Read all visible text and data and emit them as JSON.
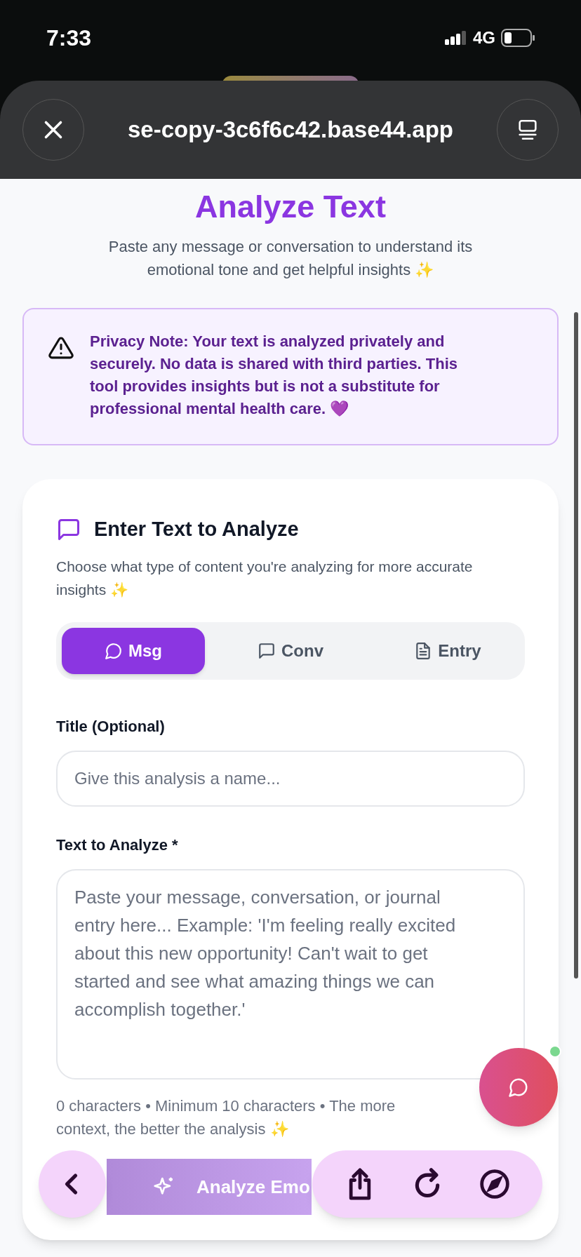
{
  "status_bar": {
    "time": "7:33",
    "network": "4G"
  },
  "browser": {
    "url": "se-copy-3c6f6c42.base44.app"
  },
  "page": {
    "title": "Analyze Text",
    "subtitle": "Paste any message or conversation to understand its emotional tone and get helpful insights ✨"
  },
  "privacy_note": {
    "text": "**Privacy Note:** Your text is analyzed privately and securely. No data is shared with third parties. This tool provides insights but is not a substitute for professional mental health care. 💜"
  },
  "card": {
    "title": "Enter Text to Analyze",
    "description": "Choose what type of content you're analyzing for more accurate insights ✨",
    "tabs": [
      {
        "label": "Msg",
        "kind": "message",
        "selected": true
      },
      {
        "label": "Conv",
        "kind": "conversation",
        "selected": false
      },
      {
        "label": "Entry",
        "kind": "document",
        "selected": false
      }
    ],
    "title_field": {
      "label": "Title (Optional)",
      "placeholder": "Give this analysis a name..."
    },
    "text_field": {
      "label": "Text to Analyze *",
      "placeholder": "Paste your message, conversation, or journal entry here... Example: 'I'm feeling really excited about this new opportunity! Can't wait to get started and see what amazing things we can accomplish together.'"
    },
    "helper": "0 characters • Minimum 10 characters • The more context, the better the analysis ✨",
    "analyze_button": "Analyze Emo"
  },
  "chat_button": {
    "online": true
  }
}
